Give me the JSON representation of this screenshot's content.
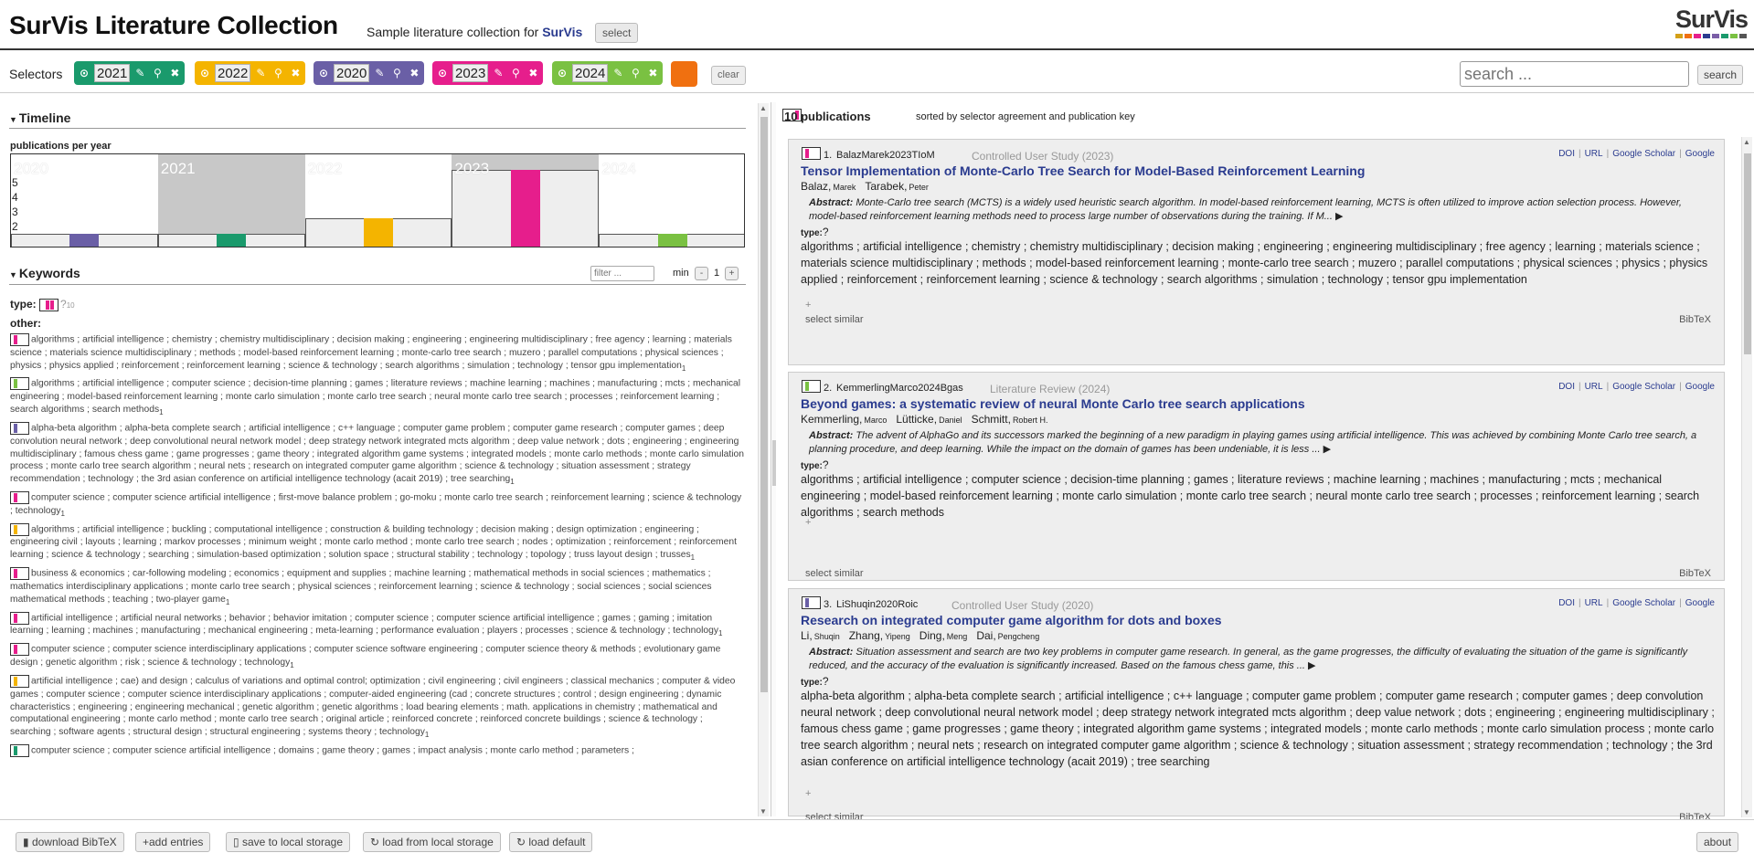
{
  "header": {
    "title": "SurVis Literature Collection",
    "subtitle_prefix": "Sample literature collection for ",
    "subtitle_link": "SurVis",
    "select_label": "select",
    "logo_text": "SurVis",
    "logo_colors": [
      "#d4a017",
      "#f07010",
      "#e61e8c",
      "#2a3b8f",
      "#7b5ea7",
      "#1a9a6c",
      "#7ac142",
      "#555"
    ]
  },
  "selectors": {
    "label": "Selectors",
    "items": [
      {
        "value": "2021",
        "color": "#1a9a6c"
      },
      {
        "value": "2022",
        "color": "#f4b400"
      },
      {
        "value": "2020",
        "color": "#6a5fa6"
      },
      {
        "value": "2023",
        "color": "#e61e8c"
      },
      {
        "value": "2024",
        "color": "#7ac142"
      }
    ],
    "extra_color": "#f07010",
    "clear_label": "clear"
  },
  "search": {
    "placeholder": "search ...",
    "button_label": "search"
  },
  "timeline": {
    "heading": "Timeline",
    "label": "publications per year",
    "years": [
      {
        "year": "2020",
        "count": 1,
        "color": "#6a5fa6",
        "highlight": false
      },
      {
        "year": "2021",
        "count": 1,
        "color": "#1a9a6c",
        "highlight": true
      },
      {
        "year": "2022",
        "count": 2,
        "color": "#f4b400",
        "highlight": false
      },
      {
        "year": "2023",
        "count": 5,
        "color": "#e61e8c",
        "highlight": true
      },
      {
        "year": "2024",
        "count": 1,
        "color": "#7ac142",
        "highlight": false
      }
    ],
    "y_ticks": [
      "2",
      "3",
      "4",
      "5"
    ]
  },
  "keywords": {
    "heading": "Keywords",
    "filter_placeholder": "filter ...",
    "min_label": "min",
    "min_value": "1",
    "minus": "-",
    "plus": "+",
    "type_label": "type:",
    "type_value": "?",
    "type_count": "10",
    "other_label": "other:",
    "items": [
      {
        "colors": [
          "#e61e8c"
        ],
        "text": "algorithms ; artificial intelligence ; chemistry ; chemistry multidisciplinary ; decision making ; engineering ; engineering multidisciplinary ; free agency ; learning ; materials science ; materials science multidisciplinary ; methods ; model-based reinforcement learning ; monte-carlo tree search ; muzero ; parallel computations ; physical sciences ; physics ; physics applied ; reinforcement ; reinforcement learning ; science & technology ; search algorithms ; simulation ; technology ; tensor gpu implementation",
        "freq": "1"
      },
      {
        "colors": [
          "#7ac142"
        ],
        "text": "algorithms ; artificial intelligence ; computer science ; decision-time planning ; games ; literature reviews ; machine learning ; machines ; manufacturing ; mcts ; mechanical engineering ; model-based reinforcement learning ; monte carlo simulation ; monte carlo tree search ; neural monte carlo tree search ; processes ; reinforcement learning ; search algorithms ; search methods",
        "freq": "1"
      },
      {
        "colors": [
          "#6a5fa6"
        ],
        "text": "alpha-beta algorithm ; alpha-beta complete search ; artificial intelligence ; c++ language ; computer game problem ; computer game research ; computer games ; deep convolution neural network ; deep convolutional neural network model ; deep strategy network integrated mcts algorithm ; deep value network ; dots ; engineering ; engineering multidisciplinary ; famous chess game ; game progresses ; game theory ; integrated algorithm game systems ; integrated models ; monte carlo methods ; monte carlo simulation process ; monte carlo tree search algorithm ; neural nets ; research on integrated computer game algorithm ; science & technology ; situation assessment ; strategy recommendation ; technology ; the 3rd asian conference on artificial intelligence technology (acait 2019) ; tree searching",
        "freq": "1"
      },
      {
        "colors": [
          "#e61e8c"
        ],
        "text": "computer science ; computer science artificial intelligence ; first-move balance problem ; go-moku ; monte carlo tree search ; reinforcement learning ; science & technology ; technology",
        "freq": "1"
      },
      {
        "colors": [
          "#f4b400"
        ],
        "text": "algorithms ; artificial intelligence ; buckling ; computational intelligence ; construction & building technology ; decision making ; design optimization ; engineering ; engineering civil ; layouts ; learning ; markov processes ; minimum weight ; monte carlo method ; monte carlo tree search ; nodes ; optimization ; reinforcement ; reinforcement learning ; science & technology ; searching ; simulation-based optimization ; solution space ; structural stability ; technology ; topology ; truss layout design ; trusses",
        "freq": "1"
      },
      {
        "colors": [
          "#e61e8c"
        ],
        "text": "business & economics ; car-following modeling ; economics ; equipment and supplies ; machine learning ; mathematical methods in social sciences ; mathematics ; mathematics interdisciplinary applications ; monte carlo tree search ; physical sciences ; reinforcement learning ; science & technology ; social sciences ; social sciences mathematical methods ; teaching ; two-player game",
        "freq": "1"
      },
      {
        "colors": [
          "#e61e8c"
        ],
        "text": "artificial intelligence ; artificial neural networks ; behavior ; behavior imitation ; computer science ; computer science artificial intelligence ; games ; gaming ; imitation learning ; learning ; machines ; manufacturing ; mechanical engineering ; meta-learning ; performance evaluation ; players ; processes ; science & technology ; technology",
        "freq": "1"
      },
      {
        "colors": [
          "#e61e8c"
        ],
        "text": "computer science ; computer science interdisciplinary applications ; computer science software engineering ; computer science theory & methods ; evolutionary game design ; genetic algorithm ; risk ; science & technology ; technology",
        "freq": "1"
      },
      {
        "colors": [
          "#f4b400"
        ],
        "text": "artificial intelligence ; cae) and design ; calculus of variations and optimal control; optimization ; civil engineering ; civil engineers ; classical mechanics ; computer & video games ; computer science ; computer science interdisciplinary applications ; computer-aided engineering (cad ; concrete structures ; control ; design engineering ; dynamic characteristics ; engineering ; engineering mechanical ; genetic algorithm ; genetic algorithms ; load bearing elements ; math. applications in chemistry ; mathematical and computational engineering ; monte carlo method ; monte carlo tree search ; original article ; reinforced concrete ; reinforced concrete buildings ; science & technology ; searching ; software agents ; structural design ; structural engineering ; systems theory ; technology",
        "freq": "1"
      },
      {
        "colors": [
          "#1a9a6c"
        ],
        "text": "computer science ; computer science artificial intelligence ; domains ; game theory ; games ; impact analysis ; monte carlo method ; parameters ;",
        "freq": ""
      }
    ]
  },
  "publications": {
    "count_label": "10 publications",
    "sort_label": "sorted by selector agreement and publication key",
    "links": [
      "DOI",
      "URL",
      "Google Scholar",
      "Google"
    ],
    "type_label": "type:",
    "type_value": "?",
    "plus": "+",
    "select_similar": "select similar",
    "bibtex": "BibTeX",
    "items": [
      {
        "num": "1.",
        "key": "BalazMarek2023TIoM",
        "type": "Controlled User Study  (2023)",
        "color": "#e61e8c",
        "title": "Tensor Implementation of Monte-Carlo Tree Search for Model-Based Reinforcement Learning",
        "authors": [
          {
            "last": "Balaz,",
            "first": "Marek"
          },
          {
            "last": "Tarabek,",
            "first": "Peter"
          }
        ],
        "abstract_label": "Abstract:",
        "abstract": " Monte-Carlo tree search (MCTS) is a widely used heuristic search algorithm. In model-based reinforcement learning, MCTS is often utilized to improve action selection process. However, model-based reinforcement learning methods need to process large number of observations during the training. If M... ▶",
        "keywords": "algorithms ; artificial intelligence ; chemistry ; chemistry multidisciplinary ; decision making ; engineering ; engineering multidisciplinary ; free agency ; learning ; materials science ; materials science multidisciplinary ; methods ; model-based reinforcement learning ; monte-carlo tree search ; muzero ; parallel computations ; physical sciences ; physics ; physics applied ; reinforcement ; reinforcement learning ; science & technology ; search algorithms ; simulation ; technology ; tensor gpu implementation"
      },
      {
        "num": "2.",
        "key": "KemmerlingMarco2024Bgas",
        "type": "Literature Review  (2024)",
        "color": "#7ac142",
        "title": "Beyond games: a systematic review of neural Monte Carlo tree search applications",
        "authors": [
          {
            "last": "Kemmerling,",
            "first": "Marco"
          },
          {
            "last": "Lütticke,",
            "first": "Daniel"
          },
          {
            "last": "Schmitt,",
            "first": "Robert H."
          }
        ],
        "abstract_label": "Abstract:",
        "abstract": " The advent of AlphaGo and its successors marked the beginning of a new paradigm in playing games using artificial intelligence. This was achieved by combining Monte Carlo tree search, a planning procedure, and deep learning. While the impact on the domain of games has been undeniable, it is less ... ▶",
        "keywords": "algorithms ; artificial intelligence ; computer science ; decision-time planning ; games ; literature reviews ; machine learning ; machines ; manufacturing ; mcts ; mechanical engineering ; model-based reinforcement learning ; monte carlo simulation ; monte carlo tree search ; neural monte carlo tree search ; processes ; reinforcement learning ; search algorithms ; search methods"
      },
      {
        "num": "3.",
        "key": "LiShuqin2020Roic",
        "type": "Controlled User Study  (2020)",
        "color": "#6a5fa6",
        "title": "Research on integrated computer game algorithm for dots and boxes",
        "authors": [
          {
            "last": "Li,",
            "first": "Shuqin"
          },
          {
            "last": "Zhang,",
            "first": "Yipeng"
          },
          {
            "last": "Ding,",
            "first": "Meng"
          },
          {
            "last": "Dai,",
            "first": "Pengcheng"
          }
        ],
        "abstract_label": "Abstract:",
        "abstract": " Situation assessment and search are two key problems in computer game research. In general, as the game progresses, the difficulty of evaluating the situation of the game is significantly reduced, and the accuracy of the evaluation is significantly increased. Based on the famous chess game, this ... ▶",
        "keywords": "alpha-beta algorithm ; alpha-beta complete search ; artificial intelligence ; c++ language ; computer game problem ; computer game research ; computer games ; deep convolution neural network ; deep convolutional neural network model ; deep strategy network integrated mcts algorithm ; deep value network ; dots ; engineering ; engineering multidisciplinary ; famous chess game ; game progresses ; game theory ; integrated algorithm game systems ; integrated models ; monte carlo methods ; monte carlo simulation process ; monte carlo tree search algorithm ; neural nets ; research on integrated computer game algorithm ; science & technology ; situation assessment ; strategy recommendation ; technology ; the 3rd asian conference on artificial intelligence technology (acait 2019) ; tree searching"
      }
    ]
  },
  "footer": {
    "download": "download BibTeX",
    "add": "+add entries",
    "save": "save to local storage",
    "load": "load from local storage",
    "load_default": "load default",
    "about": "about"
  }
}
